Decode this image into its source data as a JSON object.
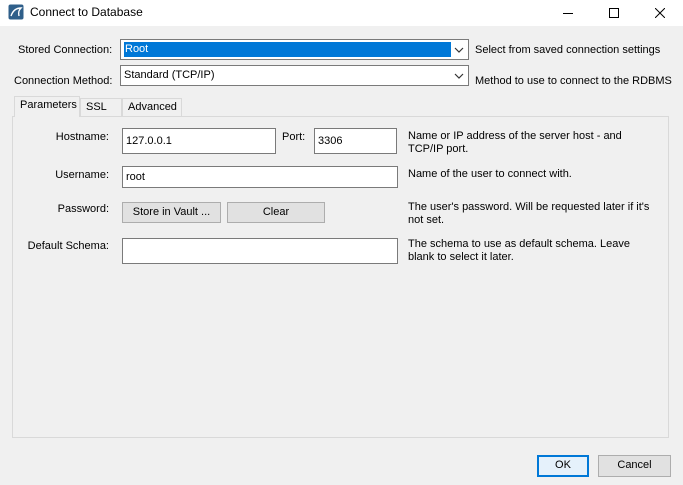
{
  "window": {
    "title": "Connect to Database",
    "icon": "dolphin-app-icon"
  },
  "stored_connection": {
    "label": "Stored Connection:",
    "value": "Root",
    "help": "Select from saved connection settings"
  },
  "connection_method": {
    "label": "Connection Method:",
    "value": "Standard (TCP/IP)",
    "help": "Method to use to connect to the RDBMS"
  },
  "tabs": [
    {
      "label": "Parameters",
      "active": true
    },
    {
      "label": "SSL",
      "active": false
    },
    {
      "label": "Advanced",
      "active": false
    }
  ],
  "parameters": {
    "hostname": {
      "label": "Hostname:",
      "value": "127.0.0.1"
    },
    "port": {
      "label": "Port:",
      "value": "3306"
    },
    "hostname_help": "Name or IP address of the server host - and TCP/IP port.",
    "username": {
      "label": "Username:",
      "value": "root",
      "help": "Name of the user to connect with."
    },
    "password": {
      "label": "Password:",
      "store_button": "Store in Vault ...",
      "clear_button": "Clear",
      "help": "The user's password. Will be requested later if it's not set."
    },
    "default_schema": {
      "label": "Default Schema:",
      "value": "",
      "help": "The schema to use as default schema. Leave blank to select it later."
    }
  },
  "footer": {
    "ok": "OK",
    "cancel": "Cancel"
  },
  "colors": {
    "selection": "#0078d7",
    "window_bg": "#f0f0f0"
  }
}
